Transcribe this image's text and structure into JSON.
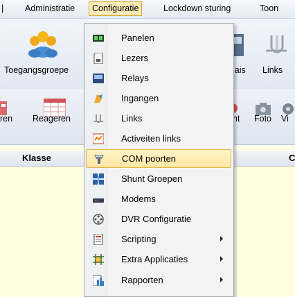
{
  "menubar": {
    "items": [
      {
        "label": "Administratie"
      },
      {
        "label": "Configuratie"
      },
      {
        "label": "Lockdown sturing"
      },
      {
        "label": "Toon"
      }
    ]
  },
  "ribbon": {
    "group_left_label": "Toegangsgroepe",
    "relais_label": "lais",
    "links_label": "Links"
  },
  "ribbon2": {
    "labels": [
      "ren",
      "Reageren",
      "nt",
      "Foto",
      "Vi"
    ]
  },
  "columns": {
    "klasse": "Klasse",
    "right": "C"
  },
  "menu": {
    "items": [
      {
        "label": "Panelen",
        "icon": "panel-icon"
      },
      {
        "label": "Lezers",
        "icon": "reader-icon"
      },
      {
        "label": "Relays",
        "icon": "relay-icon"
      },
      {
        "label": "Ingangen",
        "icon": "input-icon"
      },
      {
        "label": "Links",
        "icon": "link-icon"
      },
      {
        "label": "Activeiten links",
        "icon": "activity-links-icon"
      },
      {
        "label": "COM poorten",
        "icon": "com-port-icon",
        "highlighted": true
      },
      {
        "label": "Shunt Groepen",
        "icon": "shunt-groups-icon"
      },
      {
        "label": "Modems",
        "icon": "modem-icon"
      },
      {
        "label": "DVR Configuratie",
        "icon": "dvr-icon"
      },
      {
        "label": "Scripting",
        "icon": "script-icon",
        "submenu": true
      },
      {
        "label": "Extra Applicaties",
        "icon": "extra-apps-icon",
        "submenu": true
      },
      {
        "label": "Rapporten",
        "icon": "reports-icon",
        "submenu": true
      }
    ]
  },
  "colors": {
    "highlight": "#fde6a3",
    "highlight_border": "#e2b54a",
    "grid_background": "#fffee0"
  }
}
